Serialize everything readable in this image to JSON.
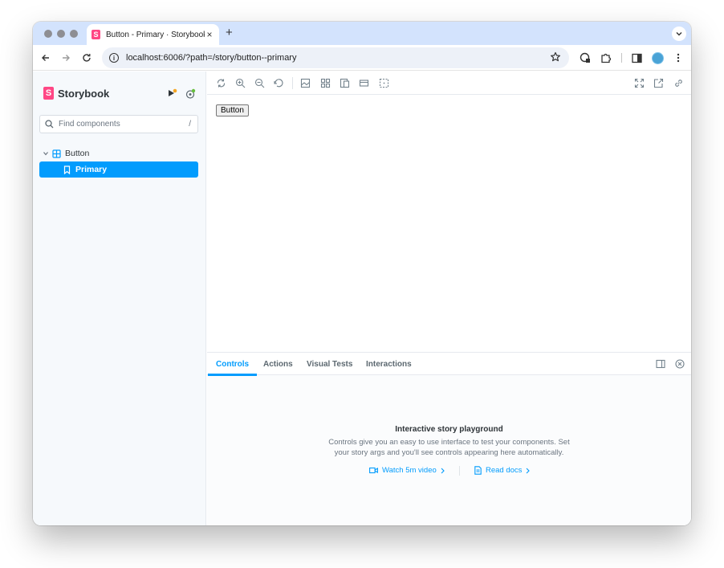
{
  "browser": {
    "tab_title": "Button - Primary · Storybook",
    "tab_favicon_letter": "S",
    "tab_close": "×",
    "new_tab": "+",
    "url": "localhost:6006/?path=/story/button--primary",
    "info_glyph": "i"
  },
  "sidebar": {
    "brand_letter": "S",
    "brand_name": "Storybook",
    "search_placeholder": "Find components",
    "search_shortcut": "/",
    "tree": {
      "group_label": "Button",
      "items": [
        {
          "label": "Primary",
          "selected": true
        }
      ]
    }
  },
  "canvas": {
    "story_button_label": "Button"
  },
  "addons": {
    "tabs": [
      {
        "label": "Controls",
        "active": true
      },
      {
        "label": "Actions",
        "active": false
      },
      {
        "label": "Visual Tests",
        "active": false
      },
      {
        "label": "Interactions",
        "active": false
      }
    ],
    "empty_title": "Interactive story playground",
    "empty_desc": "Controls give you an easy to use interface to test your components. Set your story args and you'll see controls appearing here automatically.",
    "links": {
      "video": "Watch 5m video",
      "docs": "Read docs"
    }
  },
  "colors": {
    "accent": "#029cfd",
    "brand": "#ff4785",
    "tabstrip": "#d3e3fd"
  }
}
